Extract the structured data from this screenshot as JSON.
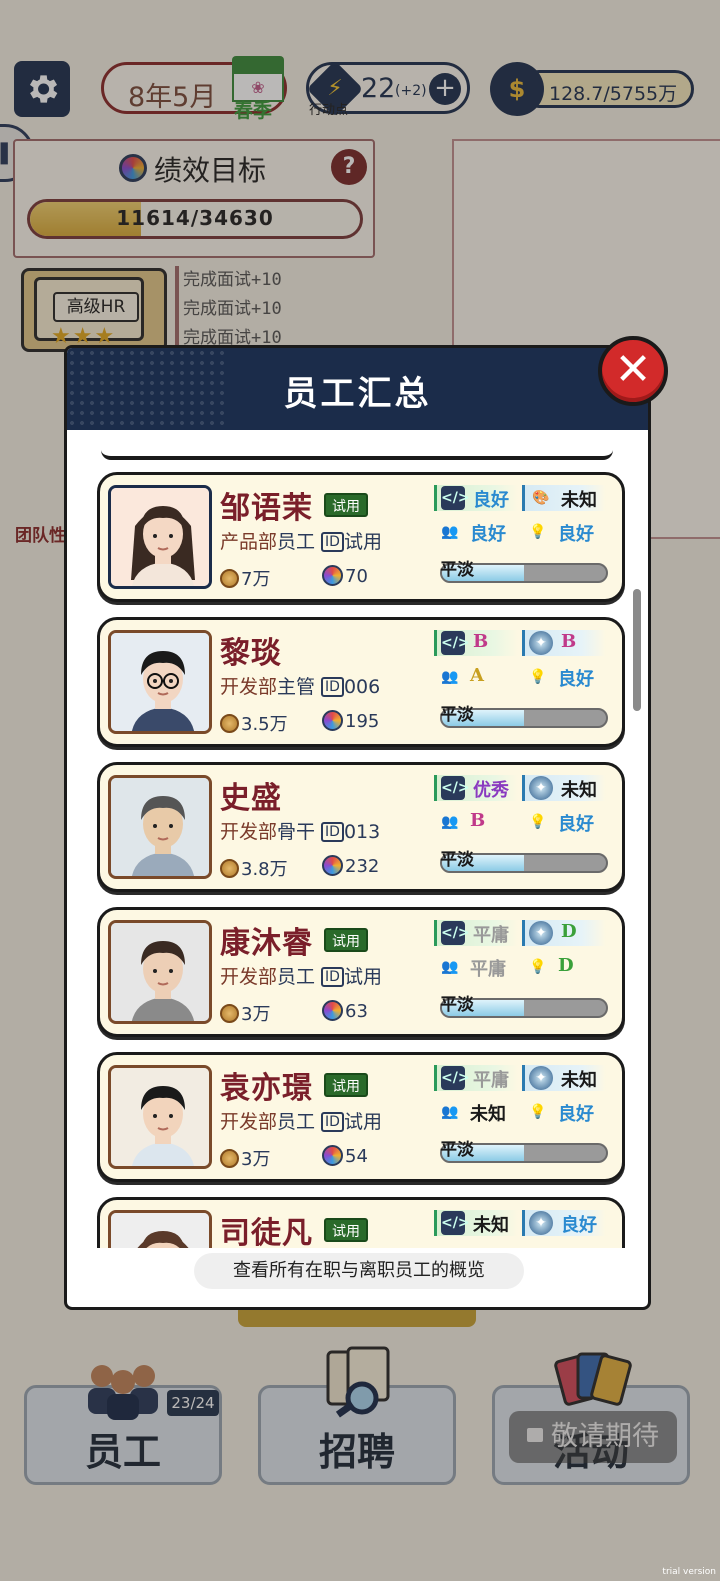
{
  "hud": {
    "date": "8年5月",
    "season": "春季",
    "action_points": "22",
    "action_points_bonus": "(+2)",
    "action_points_label": "行动点",
    "money": "128.7/5755万"
  },
  "goal": {
    "title": "绩效目标",
    "progress_text": "11614/34630",
    "progress_fraction": 0.335
  },
  "hr": {
    "label": "高级HR",
    "stars": 3,
    "tasks": [
      "完成面试+10",
      "完成面试+10",
      "完成面试+10"
    ]
  },
  "team_label": "团队性",
  "modal": {
    "title": "员工汇总",
    "footer": "查看所有在职与离职员工的概览",
    "employees": [
      {
        "name": "邹语茉",
        "tag": "试用",
        "dept": "产品部",
        "role": "员工",
        "id": "试用",
        "salary": "7万",
        "performance": "70",
        "attr1": "良好",
        "attr2": "未知",
        "attr3": "良好",
        "attr4": "良好",
        "mood": "平淡",
        "mood_level": 0.5
      },
      {
        "name": "黎琰",
        "tag": "",
        "dept": "开发部",
        "role": "主管",
        "id": "006",
        "salary": "3.5万",
        "performance": "195",
        "attr1": "B",
        "attr2": "B",
        "attr3": "A",
        "attr4": "良好",
        "mood": "平淡",
        "mood_level": 0.5
      },
      {
        "name": "史盛",
        "tag": "",
        "dept": "开发部",
        "role": "骨干",
        "id": "013",
        "salary": "3.8万",
        "performance": "232",
        "attr1": "优秀",
        "attr2": "未知",
        "attr3": "B",
        "attr4": "良好",
        "mood": "平淡",
        "mood_level": 0.5
      },
      {
        "name": "康沐睿",
        "tag": "试用",
        "dept": "开发部",
        "role": "员工",
        "id": "试用",
        "salary": "3万",
        "performance": "63",
        "attr1": "平庸",
        "attr2": "D",
        "attr3": "平庸",
        "attr4": "D",
        "mood": "平淡",
        "mood_level": 0.5
      },
      {
        "name": "袁亦璟",
        "tag": "试用",
        "dept": "开发部",
        "role": "员工",
        "id": "试用",
        "salary": "3万",
        "performance": "54",
        "attr1": "平庸",
        "attr2": "未知",
        "attr3": "未知",
        "attr4": "良好",
        "mood": "平淡",
        "mood_level": 0.5
      },
      {
        "name": "司徒凡",
        "tag": "试用",
        "attr1": "未知",
        "attr2": "良好"
      }
    ]
  },
  "nav": {
    "staff": "员工",
    "staff_count": "23/24",
    "recruit": "招聘",
    "activity": "活动",
    "coming_soon": "敬请期待"
  },
  "watermark": "trial version",
  "colors": {
    "navy": "#1b2c4a",
    "card_bg": "#fdf8e3",
    "close_red": "#d22a2a",
    "name_red": "#7a1f2a",
    "good_blue": "#2a8ad0"
  }
}
